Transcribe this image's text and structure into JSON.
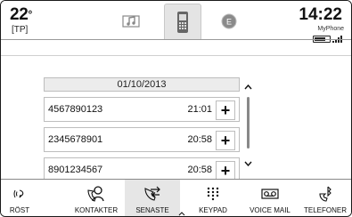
{
  "status": {
    "temperature": "22",
    "temp_unit": "°",
    "tp": "[TP]",
    "time": "14:22",
    "device": "MyPhone"
  },
  "source_tabs": [
    {
      "icon": "music-note-icon",
      "active": false
    },
    {
      "icon": "phone-device-icon",
      "active": true
    },
    {
      "icon": "e-circle-icon",
      "active": false
    }
  ],
  "calls": {
    "date": "01/10/2013",
    "entries": [
      {
        "number": "4567890123",
        "time": "21:01",
        "action": "+"
      },
      {
        "number": "2345678901",
        "time": "20:58",
        "action": "+"
      },
      {
        "number": "8901234567",
        "time": "20:58",
        "action": "+"
      }
    ]
  },
  "bottom_nav": [
    {
      "label": "RÖST",
      "icon": "voice-icon",
      "active": false
    },
    {
      "label": "KONTAKTER",
      "icon": "contacts-icon",
      "active": false
    },
    {
      "label": "SENASTE",
      "icon": "recent-calls-icon",
      "active": true
    },
    {
      "label": "KEYPAD",
      "icon": "keypad-icon",
      "active": false
    },
    {
      "label": "VOICE MAIL",
      "icon": "voicemail-icon",
      "active": false
    },
    {
      "label": "TELEFONER",
      "icon": "phones-icon",
      "active": false
    }
  ]
}
